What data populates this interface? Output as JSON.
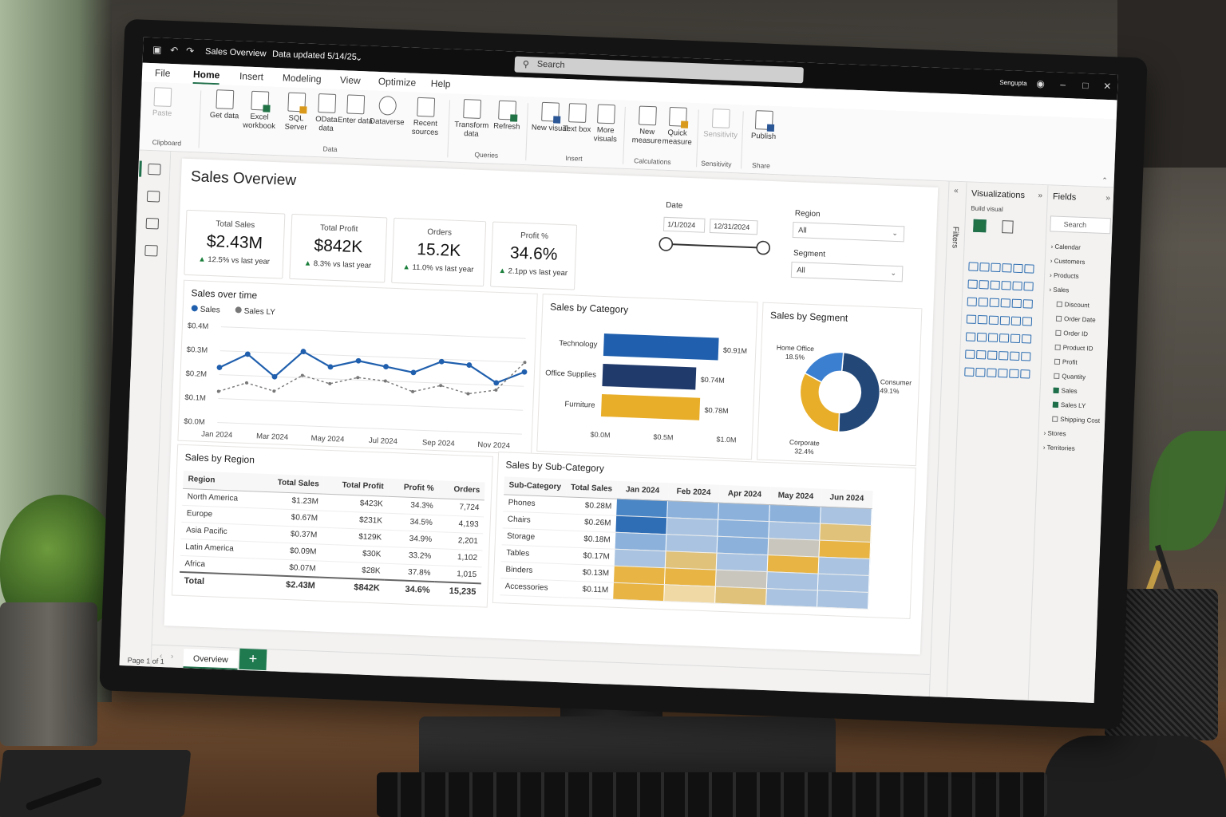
{
  "titlebar": {
    "doc_title": "Sales Overview",
    "updated": "Data updated 5/14/25",
    "search_placeholder": "Search",
    "user": "Sengupta"
  },
  "menu": [
    "File",
    "Home",
    "Insert",
    "Modeling",
    "View",
    "Optimize",
    "Help"
  ],
  "menu_active": "Home",
  "ribbon": {
    "clipboard": {
      "paste": "Paste",
      "group": "Clipboard"
    },
    "data": {
      "get_data": "Get data",
      "excel": "Excel workbook",
      "sql": "SQL Server",
      "odata": "OData data",
      "enter": "Enter data",
      "dataverse": "Dataverse",
      "recent": "Recent sources",
      "group": "Data"
    },
    "queries": {
      "transform": "Transform data",
      "refresh": "Refresh",
      "group": "Queries"
    },
    "insert": {
      "new_visual": "New visual",
      "text_box": "Text box",
      "more_visuals": "More visuals",
      "group": "Insert"
    },
    "calculations": {
      "new_measure": "New measure",
      "quick_measure": "Quick measure",
      "group": "Calculations"
    },
    "sensitivity": {
      "label": "Sensitivity",
      "group": "Sensitivity"
    },
    "share": {
      "publish": "Publish",
      "group": "Share"
    }
  },
  "report": {
    "title": "Sales Overview",
    "kpis": [
      {
        "label": "Total Sales",
        "value": "$2.43M",
        "delta": "12.5%",
        "suffix": "vs last year"
      },
      {
        "label": "Total Profit",
        "value": "$842K",
        "delta": "8.3%",
        "suffix": "vs last year"
      },
      {
        "label": "Orders",
        "value": "15.2K",
        "delta": "11.0%",
        "suffix": "vs last year"
      },
      {
        "label": "Profit %",
        "value": "34.6%",
        "delta": "2.1pp",
        "suffix": "vs last year"
      }
    ],
    "date_slicer": {
      "label": "Date",
      "start": "1/1/2024",
      "end": "12/31/2024"
    },
    "region_slicer": {
      "label": "Region",
      "value": "All"
    },
    "segment_slicer": {
      "label": "Segment",
      "value": "All"
    }
  },
  "chart_data": [
    {
      "type": "line",
      "title": "Sales over time",
      "x": [
        "Jan 2024",
        "Feb 2024",
        "Mar 2024",
        "Apr 2024",
        "May 2024",
        "Jun 2024",
        "Jul 2024",
        "Aug 2024",
        "Sep 2024",
        "Oct 2024",
        "Nov 2024",
        "Dec 2024"
      ],
      "xticks": [
        "Jan 2024",
        "Mar 2024",
        "May 2024",
        "Jul 2024",
        "Sep 2024",
        "Nov 2024"
      ],
      "yticks": [
        "$0.0M",
        "$0.1M",
        "$0.2M",
        "$0.3M",
        "$0.4M"
      ],
      "ylim": [
        0,
        0.4
      ],
      "series": [
        {
          "name": "Sales",
          "color": "#1f5fad",
          "values": [
            0.23,
            0.29,
            0.2,
            0.31,
            0.25,
            0.28,
            0.26,
            0.24,
            0.29,
            0.28,
            0.21,
            0.26
          ]
        },
        {
          "name": "Sales LY",
          "color": "#777777",
          "values": [
            0.13,
            0.17,
            0.14,
            0.21,
            0.18,
            0.21,
            0.2,
            0.16,
            0.19,
            0.16,
            0.18,
            0.3
          ]
        }
      ],
      "legend": "top-left"
    },
    {
      "type": "bar",
      "title": "Sales by Category",
      "orientation": "horizontal",
      "categories": [
        "Technology",
        "Office Supplies",
        "Furniture"
      ],
      "values": [
        0.91,
        0.74,
        0.78
      ],
      "labels": [
        "$0.91M",
        "$0.74M",
        "$0.78M"
      ],
      "colors": [
        "#1f5fad",
        "#203a6b",
        "#e8ae2a"
      ],
      "xticks": [
        "$0.0M",
        "$0.5M",
        "$1.0M"
      ],
      "xlim": [
        0,
        1.0
      ]
    },
    {
      "type": "pie",
      "title": "Sales by Segment",
      "donut": true,
      "slices": [
        {
          "name": "Consumer",
          "value": 49.1,
          "label": "49.1%",
          "color": "#234878"
        },
        {
          "name": "Corporate",
          "value": 32.4,
          "label": "32.4%",
          "color": "#e8ae2a"
        },
        {
          "name": "Home Office",
          "value": 18.5,
          "label": "18.5%",
          "color": "#3b7fd0"
        }
      ]
    },
    {
      "type": "table",
      "title": "Sales by Region",
      "columns": [
        "Region",
        "Total Sales",
        "Total Profit",
        "Profit %",
        "Orders"
      ],
      "rows": [
        [
          "North America",
          "$1.23M",
          "$423K",
          "34.3%",
          "7,724"
        ],
        [
          "Europe",
          "$0.67M",
          "$231K",
          "34.5%",
          "4,193"
        ],
        [
          "Asia Pacific",
          "$0.37M",
          "$129K",
          "34.9%",
          "2,201"
        ],
        [
          "Latin America",
          "$0.09M",
          "$30K",
          "33.2%",
          "1,102"
        ],
        [
          "Africa",
          "$0.07M",
          "$28K",
          "37.8%",
          "1,015"
        ]
      ],
      "total": [
        "Total",
        "$2.43M",
        "$842K",
        "34.6%",
        "15,235"
      ]
    },
    {
      "type": "heatmap",
      "title": "Sales by Sub-Category",
      "columns": [
        "Sub-Category",
        "Total Sales",
        "Jan 2024",
        "Feb 2024",
        "Apr 2024",
        "May 2024",
        "Jun 2024"
      ],
      "rows": [
        {
          "name": "Phones",
          "total": "$0.28M",
          "cells": [
            1,
            2,
            2,
            2,
            3
          ]
        },
        {
          "name": "Chairs",
          "total": "$0.26M",
          "cells": [
            0,
            3,
            2,
            3,
            5
          ]
        },
        {
          "name": "Storage",
          "total": "$0.18M",
          "cells": [
            2,
            3,
            2,
            4,
            6
          ]
        },
        {
          "name": "Tables",
          "total": "$0.17M",
          "cells": [
            3,
            5,
            3,
            6,
            3
          ]
        },
        {
          "name": "Binders",
          "total": "$0.13M",
          "cells": [
            6,
            6,
            4,
            3,
            3
          ]
        },
        {
          "name": "Accessories",
          "total": "$0.11M",
          "cells": [
            6,
            7,
            5,
            3,
            3
          ]
        }
      ],
      "palette": [
        "#2f6db5",
        "#4a86c6",
        "#8cb2dc",
        "#a9c3e0",
        "#c8c6bd",
        "#e0c27a",
        "#e8b544",
        "#f1d9a6"
      ]
    }
  ],
  "pages": {
    "tab": "Overview",
    "add": "+",
    "status": "Page 1 of 1"
  },
  "panes": {
    "filters": "Filters",
    "visualizations": "Visualizations",
    "build_visual": "Build visual",
    "fields": "Fields",
    "fields_search": "Search",
    "tables": [
      "Calendar",
      "Customers",
      "Products",
      "Sales"
    ],
    "sales_fields": [
      {
        "name": "Discount",
        "checked": false
      },
      {
        "name": "Order Date",
        "checked": false
      },
      {
        "name": "Order ID",
        "checked": false
      },
      {
        "name": "Product ID",
        "checked": false
      },
      {
        "name": "Profit",
        "checked": false
      },
      {
        "name": "Quantity",
        "checked": false
      },
      {
        "name": "Sales",
        "checked": true
      },
      {
        "name": "Sales LY",
        "checked": true
      },
      {
        "name": "Shipping Cost",
        "checked": false
      }
    ],
    "tables_after": [
      "Stores",
      "Territories"
    ]
  }
}
